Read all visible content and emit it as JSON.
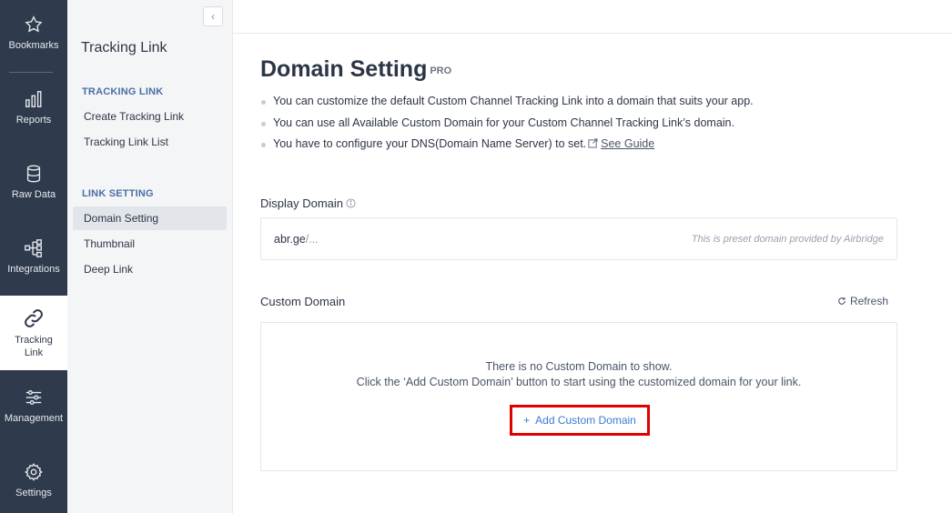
{
  "rail": {
    "items": [
      {
        "label": "Bookmarks",
        "icon": "star-icon"
      },
      {
        "label": "Reports",
        "icon": "bar-chart-icon"
      },
      {
        "label": "Raw Data",
        "icon": "database-icon"
      },
      {
        "label": "Integrations",
        "icon": "flow-icon"
      },
      {
        "label_line1": "Tracking",
        "label_line2": "Link",
        "icon": "link-icon",
        "active": true
      },
      {
        "label": "Management",
        "icon": "sliders-icon"
      },
      {
        "label": "Settings",
        "icon": "gear-icon"
      }
    ]
  },
  "subnav": {
    "collapse_glyph": "‹",
    "title": "Tracking Link",
    "sections": [
      {
        "label": "TRACKING LINK",
        "items": [
          "Create Tracking Link",
          "Tracking Link List"
        ]
      },
      {
        "label": "LINK SETTING",
        "items": [
          "Domain Setting",
          "Thumbnail",
          "Deep Link"
        ]
      }
    ],
    "active_item": "Domain Setting"
  },
  "main": {
    "title": "Domain Setting",
    "badge": "PRO",
    "bullets": [
      "You can customize the default Custom Channel Tracking Link into a domain that suits your app.",
      "You can use all Available Custom Domain for your Custom Channel Tracking Link’s domain.",
      "You have to configure your DNS(Domain Name Server) to set."
    ],
    "guide_link": "See Guide",
    "display_domain": {
      "label": "Display Domain",
      "value": "abr.ge",
      "suffix": "/...",
      "hint": "This is preset domain provided by Airbridge"
    },
    "custom_domain": {
      "label": "Custom Domain",
      "refresh": "Refresh",
      "empty_line1": "There is no Custom Domain to show.",
      "empty_line2": "Click the ‘Add Custom Domain’ button to start using the customized domain for your link.",
      "add_plus": "+",
      "add_button": "Add Custom Domain"
    }
  },
  "colors": {
    "rail_bg": "#2f3a4c",
    "accent_blue": "#3b7bd6",
    "highlight_red": "#e00000",
    "section_label": "#4a6fa5"
  }
}
